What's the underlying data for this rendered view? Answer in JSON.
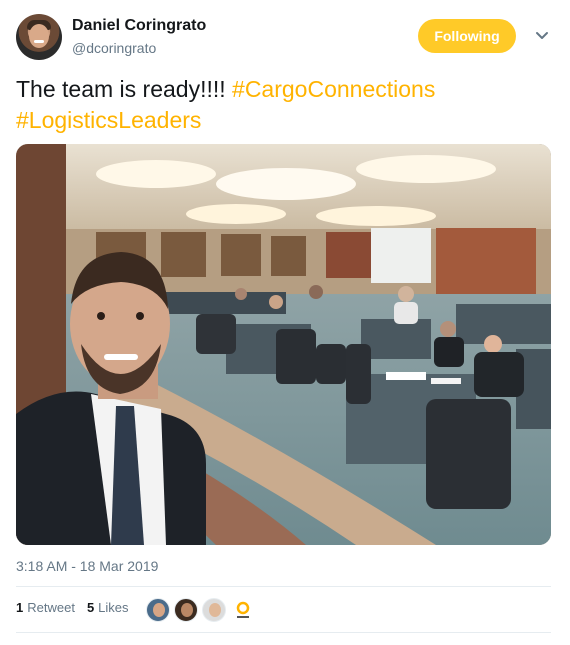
{
  "author": {
    "name": "Daniel Coringrato",
    "handle": "@dcoringrato"
  },
  "follow_button": {
    "label": "Following"
  },
  "tweet": {
    "text_plain": "The team is ready!!!! ",
    "hashtags": [
      "#CargoConnections",
      "#LogisticsLeaders"
    ]
  },
  "timestamp": "3:18 AM - 18 Mar 2019",
  "stats": {
    "retweets_count": "1",
    "retweets_label": "Retweet",
    "likes_count": "5",
    "likes_label": "Likes"
  },
  "colors": {
    "accent": "#ffb300",
    "follow_bg": "#ffca28",
    "muted": "#657786",
    "text": "#14171a"
  },
  "icons": {
    "menu": "chevron-down-icon"
  }
}
